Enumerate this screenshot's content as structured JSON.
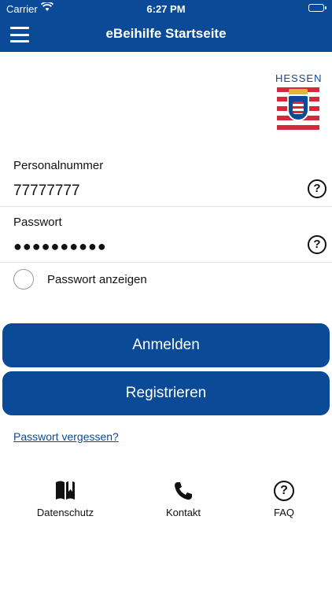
{
  "status_bar": {
    "carrier": "Carrier",
    "time": "6:27 PM"
  },
  "header": {
    "title": "eBeihilfe Startseite"
  },
  "logo": {
    "text": "HESSEN"
  },
  "form": {
    "personal_number": {
      "label": "Personalnummer",
      "value": "77777777"
    },
    "password": {
      "label": "Passwort",
      "value": "●●●●●●●●●●"
    },
    "show_password_label": "Passwort anzeigen"
  },
  "buttons": {
    "login": "Anmelden",
    "register": "Registrieren"
  },
  "links": {
    "forgot_password": "Passwort vergessen?"
  },
  "footer": {
    "items": [
      {
        "label": "Datenschutz",
        "icon": "book-icon"
      },
      {
        "label": "Kontakt",
        "icon": "phone-icon"
      },
      {
        "label": "FAQ",
        "icon": "question-icon"
      }
    ]
  },
  "colors": {
    "primary": "#0a4a97",
    "hessen_red": "#d5283a"
  }
}
